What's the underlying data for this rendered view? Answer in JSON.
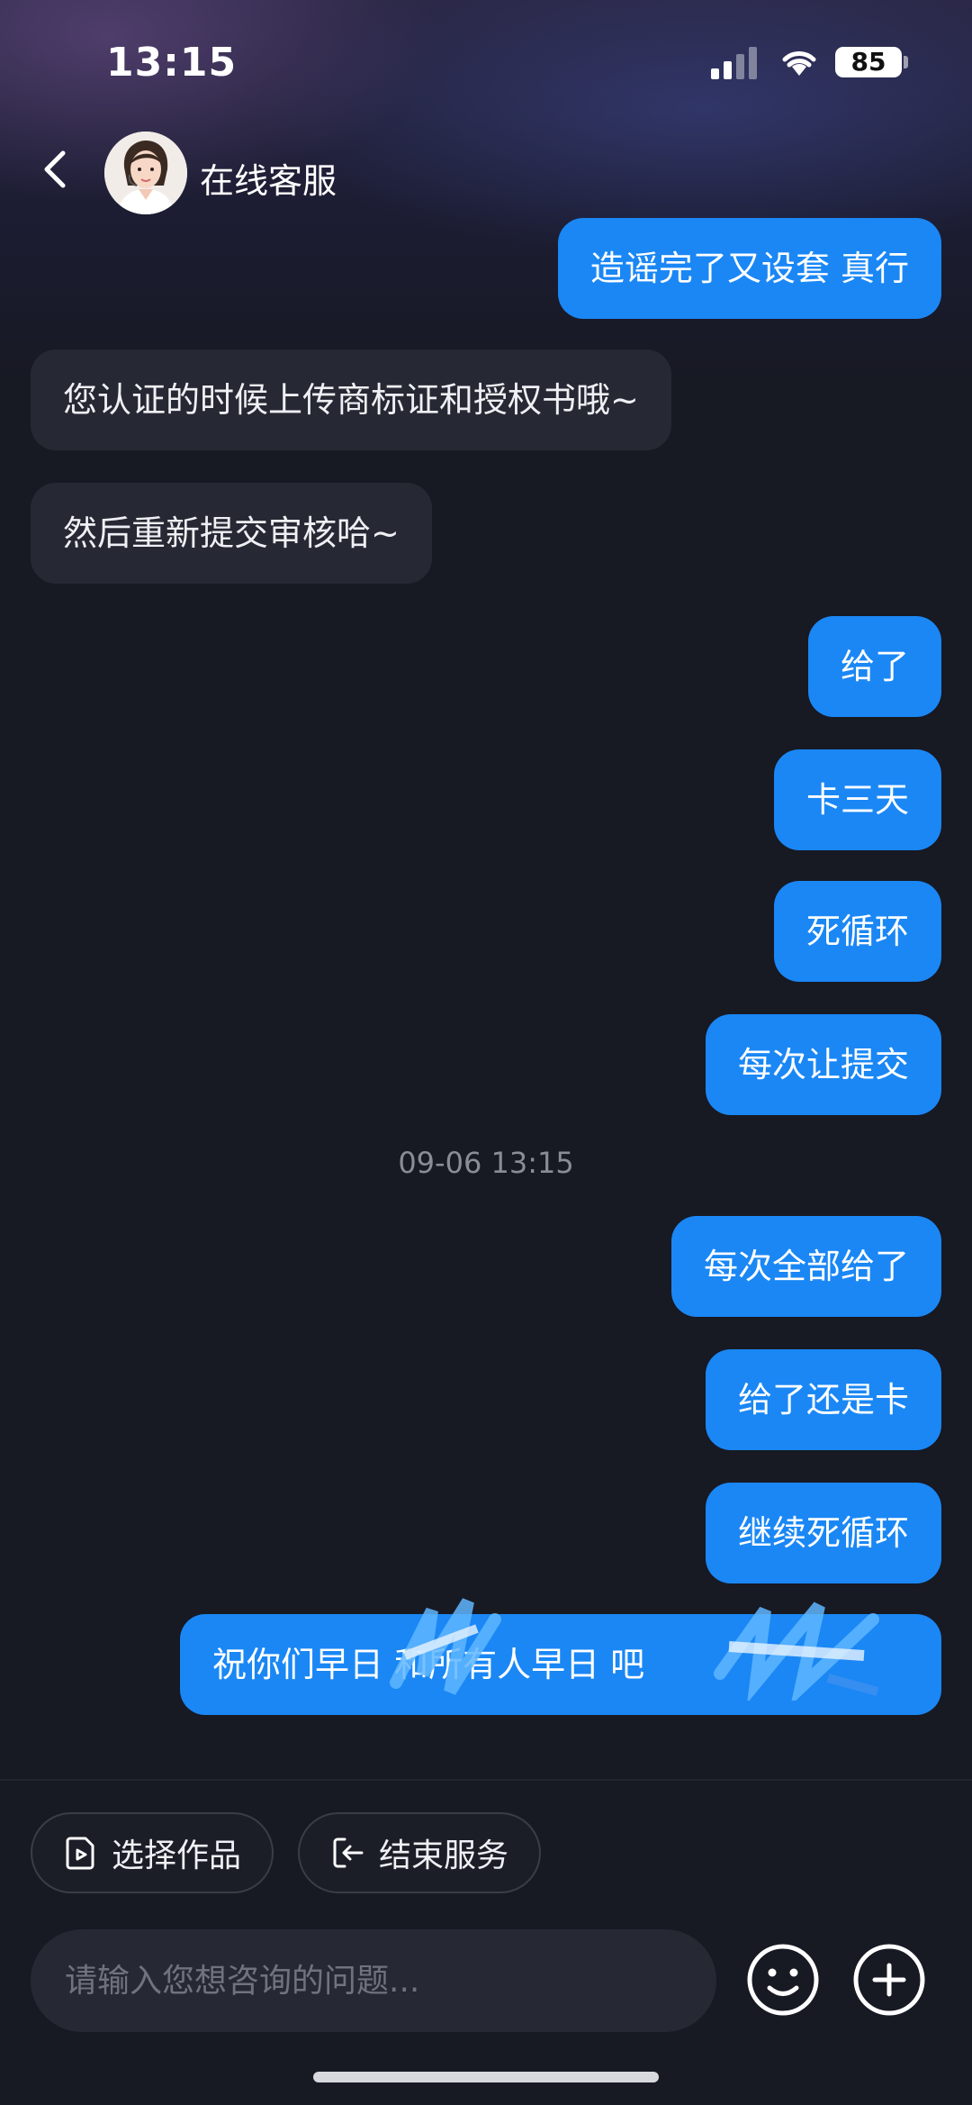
{
  "status_bar": {
    "time": "13:15",
    "battery": "85"
  },
  "header": {
    "title": "在线客服",
    "avatar_alt": "客服头像"
  },
  "messages": [
    {
      "side": "out",
      "text": "造谣完了又设套 真行"
    },
    {
      "side": "in",
      "text": "您认证的时候上传商标证和授权书哦~"
    },
    {
      "side": "in",
      "text": "然后重新提交审核哈~"
    },
    {
      "side": "out",
      "text": "给了"
    },
    {
      "side": "out",
      "text": "卡三天"
    },
    {
      "side": "out",
      "text": "死循环"
    },
    {
      "side": "out",
      "text": "每次让提交"
    },
    {
      "side": "out",
      "text": "每次全部给了"
    },
    {
      "side": "out",
      "text": "给了还是卡"
    },
    {
      "side": "out",
      "text": "继续死循环"
    },
    {
      "side": "out",
      "text": "祝你们早日      和所有人早日        吧"
    }
  ],
  "timestamp": "09-06 13:15",
  "actions": {
    "select_work": "选择作品",
    "end_service": "结束服务"
  },
  "input": {
    "placeholder": "请输入您想咨询的问题..."
  },
  "colors": {
    "outgoing_bubble": "#1a87f5",
    "incoming_bubble": "#262833",
    "background": "#171923"
  },
  "icons": [
    "back-arrow-icon",
    "signal-icon",
    "wifi-icon",
    "battery-icon",
    "video-file-icon",
    "exit-icon",
    "emoji-icon",
    "plus-icon"
  ]
}
